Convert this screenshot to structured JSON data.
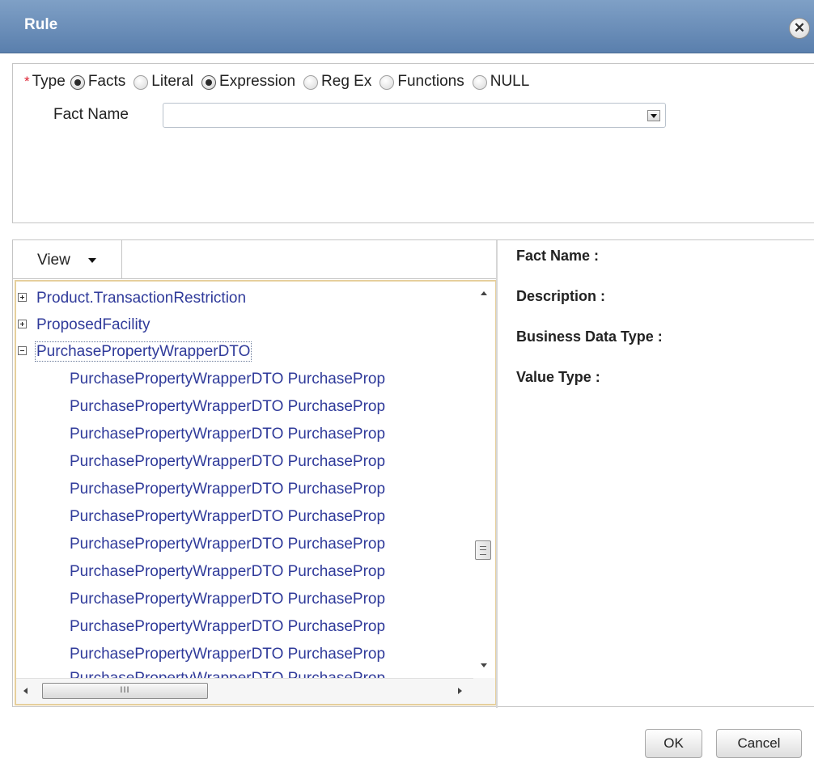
{
  "dialog": {
    "title": "Rule",
    "close_glyph": "✕"
  },
  "type_selector": {
    "required_marker": "*",
    "label": "Type",
    "options": [
      "Facts",
      "Literal",
      "Expression",
      "Reg Ex",
      "Functions",
      "NULL"
    ],
    "selected": "Facts"
  },
  "fact_name": {
    "label": "Fact Name",
    "value": ""
  },
  "view_menu": {
    "label": "View"
  },
  "tree": {
    "nodes": [
      {
        "label": "Product.TransactionRestriction",
        "expanded": false
      },
      {
        "label": "ProposedFacility",
        "expanded": false
      },
      {
        "label": "PurchasePropertyWrapperDTO",
        "expanded": true
      }
    ],
    "children": [
      "PurchasePropertyWrapperDTO PurchaseProp",
      "PurchasePropertyWrapperDTO PurchaseProp",
      "PurchasePropertyWrapperDTO PurchaseProp",
      "PurchasePropertyWrapperDTO PurchaseProp",
      "PurchasePropertyWrapperDTO PurchaseProp",
      "PurchasePropertyWrapperDTO PurchaseProp",
      "PurchasePropertyWrapperDTO PurchaseProp",
      "PurchasePropertyWrapperDTO PurchaseProp",
      "PurchasePropertyWrapperDTO PurchaseProp",
      "PurchasePropertyWrapperDTO PurchaseProp",
      "PurchasePropertyWrapperDTO PurchaseProp",
      "PurchasePropertyWrapperDTO PurchaseProp"
    ],
    "hscroll_grip": "III"
  },
  "details": {
    "fact_name": "Fact Name :",
    "description": "Description :",
    "business_data_type": "Business Data Type :",
    "value_type": "Value Type :"
  },
  "buttons": {
    "ok": "OK",
    "cancel": "Cancel"
  },
  "colors": {
    "title_bar": "#6a8cb7",
    "tree_link": "#2f3a9a",
    "tree_focus_border": "#e6cf9c",
    "required": "#dd2233"
  }
}
